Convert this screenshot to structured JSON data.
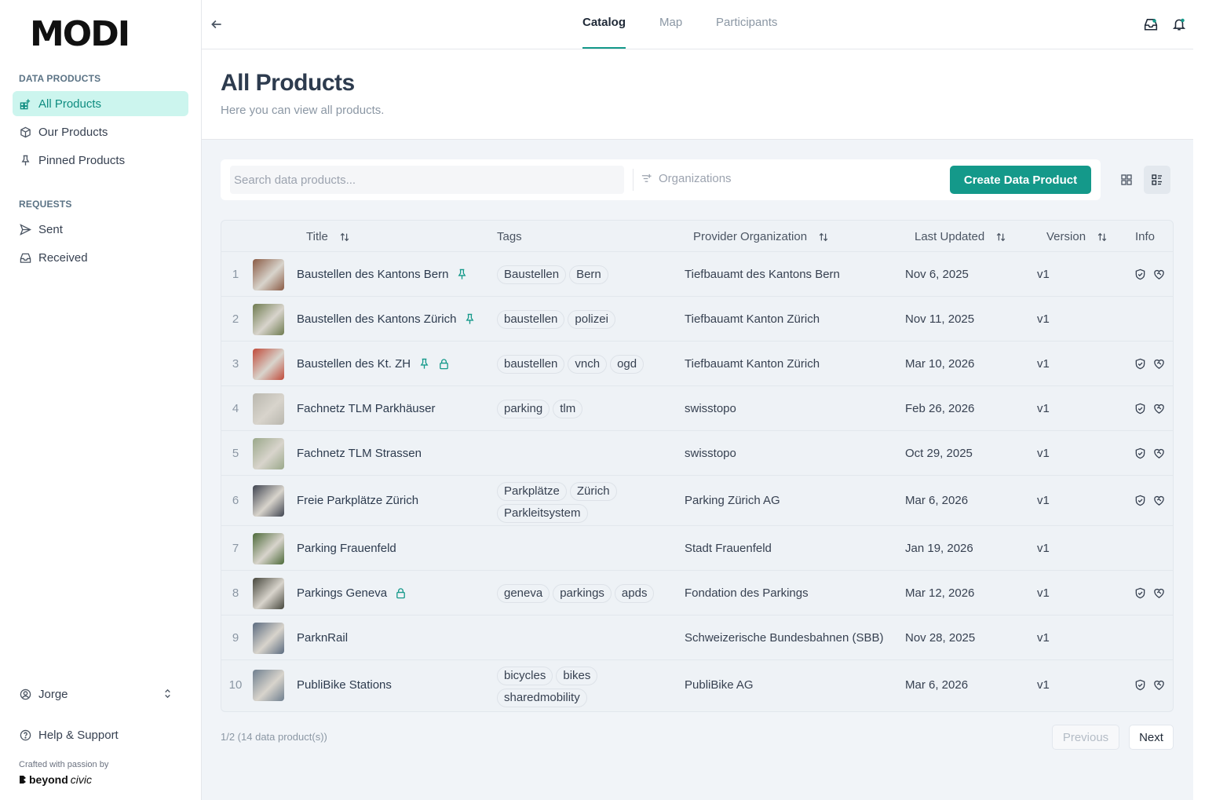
{
  "logo": "MODI",
  "sidebar": {
    "section1": "DATA PRODUCTS",
    "items1": [
      {
        "label": "All Products",
        "icon": "grid-plus-icon",
        "active": true
      },
      {
        "label": "Our Products",
        "icon": "box-icon",
        "active": false
      },
      {
        "label": "Pinned Products",
        "icon": "pin-icon",
        "active": false
      }
    ],
    "section2": "REQUESTS",
    "items2": [
      {
        "label": "Sent",
        "icon": "send-icon"
      },
      {
        "label": "Received",
        "icon": "inbox-icon"
      }
    ],
    "user": "Jorge",
    "help": "Help & Support",
    "crafted": "Crafted with passion by",
    "brand_a": "beyond",
    "brand_b": "civic"
  },
  "topbar": {
    "tabs": [
      "Catalog",
      "Map",
      "Participants"
    ],
    "active_tab": "Catalog"
  },
  "header": {
    "title": "All Products",
    "subtitle": "Here you can view all products."
  },
  "toolbar": {
    "search_placeholder": "Search data products...",
    "organizations": "Organizations",
    "create_button": "Create Data Product"
  },
  "table": {
    "columns": {
      "title": "Title",
      "tags": "Tags",
      "provider": "Provider Organization",
      "updated": "Last Updated",
      "version": "Version",
      "info": "Info"
    },
    "rows": [
      {
        "n": "1",
        "title": "Baustellen des Kantons Bern",
        "pinned": true,
        "locked": false,
        "tags": [
          "Baustellen",
          "Bern"
        ],
        "provider": "Tiefbauamt des Kantons Bern",
        "updated": "Nov 6, 2025",
        "version": "v1",
        "info": true,
        "thumb": "#8a5a44"
      },
      {
        "n": "2",
        "title": "Baustellen des Kantons Zürich",
        "pinned": true,
        "locked": false,
        "tags": [
          "baustellen",
          "polizei"
        ],
        "provider": "Tiefbauamt Kanton Zürich",
        "updated": "Nov 11, 2025",
        "version": "v1",
        "info": false,
        "thumb": "#6e7b4f"
      },
      {
        "n": "3",
        "title": "Baustellen des Kt. ZH",
        "pinned": true,
        "locked": true,
        "tags": [
          "baustellen",
          "vnch",
          "ogd"
        ],
        "provider": "Tiefbauamt Kanton Zürich",
        "updated": "Mar 10, 2026",
        "version": "v1",
        "info": true,
        "thumb": "#c04a3a"
      },
      {
        "n": "4",
        "title": "Fachnetz TLM Parkhäuser",
        "pinned": false,
        "locked": false,
        "tags": [
          "parking",
          "tlm"
        ],
        "provider": "swisstopo",
        "updated": "Feb 26, 2026",
        "version": "v1",
        "info": true,
        "thumb": "#b9b7ae"
      },
      {
        "n": "5",
        "title": "Fachnetz TLM Strassen",
        "pinned": false,
        "locked": false,
        "tags": [],
        "provider": "swisstopo",
        "updated": "Oct 29, 2025",
        "version": "v1",
        "info": true,
        "thumb": "#9aa88a"
      },
      {
        "n": "6",
        "title": "Freie Parkplätze Zürich",
        "pinned": false,
        "locked": false,
        "tags": [
          "Parkplätze",
          "Zürich",
          "Parkleitsystem"
        ],
        "provider": "Parking Zürich AG",
        "updated": "Mar 6, 2026",
        "version": "v1",
        "info": true,
        "thumb": "#3f4450"
      },
      {
        "n": "7",
        "title": "Parking Frauenfeld",
        "pinned": false,
        "locked": false,
        "tags": [],
        "provider": "Stadt Frauenfeld",
        "updated": "Jan 19, 2026",
        "version": "v1",
        "info": false,
        "thumb": "#4d6a3a"
      },
      {
        "n": "8",
        "title": "Parkings Geneva",
        "pinned": false,
        "locked": true,
        "tags": [
          "geneva",
          "parkings",
          "apds"
        ],
        "provider": "Fondation des Parkings",
        "updated": "Mar 12, 2026",
        "version": "v1",
        "info": true,
        "thumb": "#46463c"
      },
      {
        "n": "9",
        "title": "ParknRail",
        "pinned": false,
        "locked": false,
        "tags": [],
        "provider": "Schweizerische Bundesbahnen (SBB)",
        "updated": "Nov 28, 2025",
        "version": "v1",
        "info": false,
        "thumb": "#5b6b80"
      },
      {
        "n": "10",
        "title": "PubliBike Stations",
        "pinned": false,
        "locked": false,
        "tags": [
          "bicycles",
          "bikes",
          "sharedmobility"
        ],
        "provider": "PubliBike AG",
        "updated": "Mar 6, 2026",
        "version": "v1",
        "info": true,
        "thumb": "#6f7f8f"
      }
    ]
  },
  "pagination": {
    "info": "1/2 (14 data product(s))",
    "previous": "Previous",
    "next": "Next"
  },
  "colors": {
    "accent": "#14998a",
    "active_bg": "#ccf5ee"
  }
}
